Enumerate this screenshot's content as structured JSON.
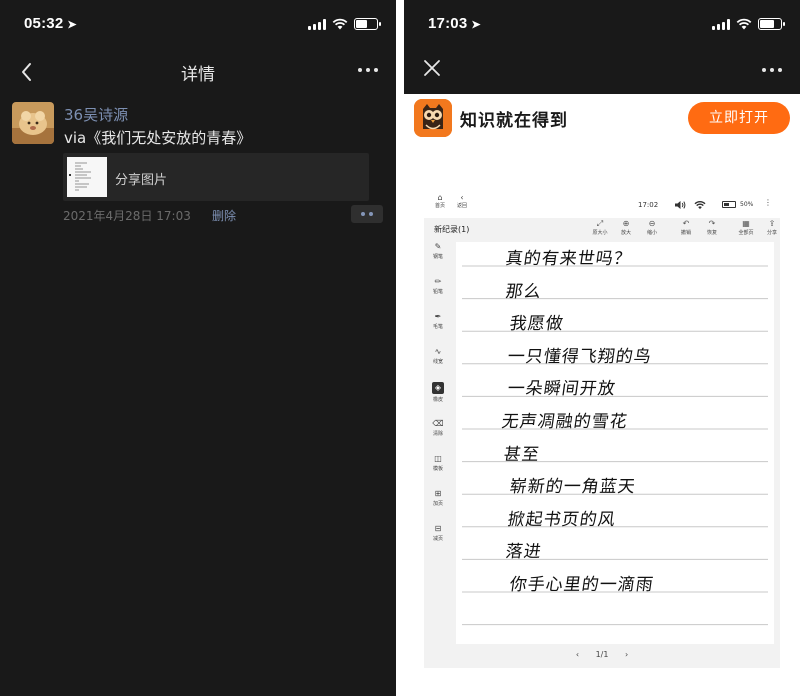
{
  "left_phone": {
    "status": {
      "time": "05:32",
      "location_icon": "location-arrow-icon"
    },
    "nav": {
      "title": "详情",
      "back_icon": "chevron-left-icon",
      "more_icon": "more-dots-icon"
    },
    "post": {
      "user_name": "36吴诗源",
      "via_text": "via《我们无处安放的青春》",
      "share_label": "分享图片",
      "timestamp": "2021年4月28日 17:03",
      "delete_label": "删除"
    },
    "colors": {
      "background": "#191919",
      "link": "#7d90b3"
    }
  },
  "right_phone": {
    "status": {
      "time": "17:03"
    },
    "nav": {
      "close_icon": "close-icon",
      "more_icon": "more-dots-icon"
    },
    "banner": {
      "slogan": "知识就在得到",
      "open_button": "立即打开",
      "accent": "#ff6b12"
    },
    "tablet": {
      "time": "17:02",
      "battery": "50%",
      "top_left": [
        {
          "label": "首页",
          "icon": "home-icon"
        },
        {
          "label": "返回",
          "icon": "back-icon"
        }
      ],
      "doc_title": "新纪录(1)",
      "toolbar": [
        {
          "label": "原大小",
          "icon": "fit-icon"
        },
        {
          "label": "放大",
          "icon": "zoom-in-icon"
        },
        {
          "label": "缩小",
          "icon": "zoom-out-icon"
        },
        {
          "label": "撤销",
          "icon": "undo-icon"
        },
        {
          "label": "恢复",
          "icon": "redo-icon"
        },
        {
          "label": "全部页",
          "icon": "grid-icon"
        },
        {
          "label": "分享",
          "icon": "share-icon"
        }
      ],
      "sidebar": [
        {
          "label": "钢笔",
          "icon": "pen-icon"
        },
        {
          "label": "铅笔",
          "icon": "pencil-icon"
        },
        {
          "label": "毛笔",
          "icon": "brush-icon"
        },
        {
          "label": "线宽",
          "icon": "line-width-icon"
        },
        {
          "label": "橡皮",
          "icon": "eraser-icon",
          "active": true
        },
        {
          "label": "清除",
          "icon": "clear-icon"
        },
        {
          "label": "模板",
          "icon": "template-icon"
        },
        {
          "label": "加页",
          "icon": "add-page-icon"
        },
        {
          "label": "减页",
          "icon": "remove-page-icon"
        }
      ],
      "handwritten_lines": [
        "真的有来世吗？",
        "那么",
        "我愿做",
        "一只懂得飞翔的鸟",
        "一朵瞬间开放",
        "无声凋融的雪花",
        "甚至",
        "崭新的一角蓝天",
        "掀起书页的风",
        "落进",
        "你手心里的一滴雨"
      ],
      "pager": "1/1"
    }
  }
}
